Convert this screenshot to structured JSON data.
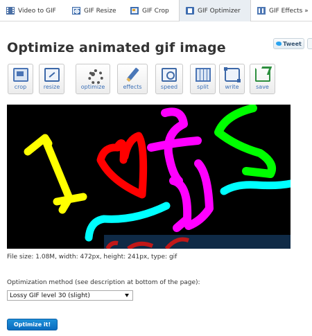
{
  "nav": {
    "tabs": [
      {
        "label": "Video to GIF",
        "icon": "film-icon"
      },
      {
        "label": "GIF Resize",
        "icon": "resize-icon"
      },
      {
        "label": "GIF Crop",
        "icon": "crop-icon"
      },
      {
        "label": "GIF Optimizer",
        "icon": "optimizer-icon",
        "active": true
      },
      {
        "label": "GIF Effects »",
        "icon": "effects-icon"
      }
    ]
  },
  "page": {
    "title": "Optimize animated gif image",
    "tweet_label": "Tweet"
  },
  "toolbar": {
    "tools": [
      {
        "label": "crop",
        "icon": "crop-icon"
      },
      {
        "label": "resize",
        "icon": "resize-icon"
      },
      {
        "label": "optimize",
        "icon": "gear-icon"
      },
      {
        "label": "effects",
        "icon": "pen-icon"
      },
      {
        "label": "speed",
        "icon": "speed-icon"
      },
      {
        "label": "split",
        "icon": "filmstrip-icon"
      },
      {
        "label": "write",
        "icon": "write-icon"
      },
      {
        "label": "save",
        "icon": "save-icon"
      }
    ]
  },
  "preview": {
    "image_text": "1oSS"
  },
  "file_info": "File size: 1.08M, width: 472px, height: 241px, type: gif",
  "form": {
    "method_label": "Optimization method (see description at bottom of the page):",
    "method_selected": "Lossy GIF level 30 (slight)",
    "submit_label": "Optimize it!"
  },
  "colors": {
    "accent": "#0a6cbf",
    "link": "#3a6fb7",
    "yellow_stroke": "#ffff00",
    "red_stroke": "#ff0000",
    "magenta_stroke": "#ff00ff",
    "green_stroke": "#00ff00",
    "cyan_stroke": "#00ffff"
  }
}
